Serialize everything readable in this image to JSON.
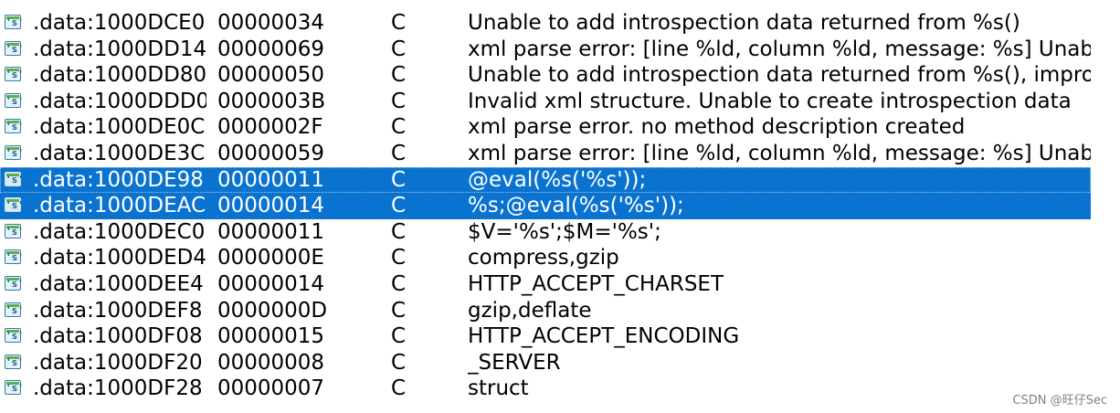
{
  "window": {
    "row_icon": "string-literal-icon",
    "icon_glyph": "'s'",
    "selection_color": "#0a73d0"
  },
  "strings": [
    {
      "address": ".data:1000DCE0",
      "length": "00000034",
      "type": "C",
      "string": "Unable to add introspection data returned from %s()",
      "selected": false
    },
    {
      "address": ".data:1000DD14",
      "length": "00000069",
      "type": "C",
      "string": "xml parse error: [line %ld, column %ld, message: %s] Unable",
      "selected": false
    },
    {
      "address": ".data:1000DD80",
      "length": "00000050",
      "type": "C",
      "string": "Unable to add introspection data returned from %s(), impro",
      "selected": false
    },
    {
      "address": ".data:1000DDD0",
      "length": "0000003B",
      "type": "C",
      "string": "Invalid xml structure. Unable to create introspection data",
      "selected": false
    },
    {
      "address": ".data:1000DE0C",
      "length": "0000002F",
      "type": "C",
      "string": "xml parse error. no method description created",
      "selected": false
    },
    {
      "address": ".data:1000DE3C",
      "length": "00000059",
      "type": "C",
      "string": "xml parse error: [line %ld, column %ld, message: %s] Unable",
      "selected": false
    },
    {
      "address": ".data:1000DE98",
      "length": "00000011",
      "type": "C",
      "string": "@eval(%s('%s'));",
      "selected": true
    },
    {
      "address": ".data:1000DEAC",
      "length": "00000014",
      "type": "C",
      "string": "%s;@eval(%s('%s'));",
      "selected": true
    },
    {
      "address": ".data:1000DEC0",
      "length": "00000011",
      "type": "C",
      "string": "$V='%s';$M='%s';",
      "selected": false
    },
    {
      "address": ".data:1000DED4",
      "length": "0000000E",
      "type": "C",
      "string": "compress,gzip",
      "selected": false
    },
    {
      "address": ".data:1000DEE4",
      "length": "00000014",
      "type": "C",
      "string": "HTTP_ACCEPT_CHARSET",
      "selected": false
    },
    {
      "address": ".data:1000DEF8",
      "length": "0000000D",
      "type": "C",
      "string": "gzip,deflate",
      "selected": false
    },
    {
      "address": ".data:1000DF08",
      "length": "00000015",
      "type": "C",
      "string": "HTTP_ACCEPT_ENCODING",
      "selected": false
    },
    {
      "address": ".data:1000DF20",
      "length": "00000008",
      "type": "C",
      "string": "_SERVER",
      "selected": false
    },
    {
      "address": ".data:1000DF28",
      "length": "00000007",
      "type": "C",
      "string": "struct",
      "selected": false
    }
  ],
  "watermark": "CSDN @旺仔Sec"
}
